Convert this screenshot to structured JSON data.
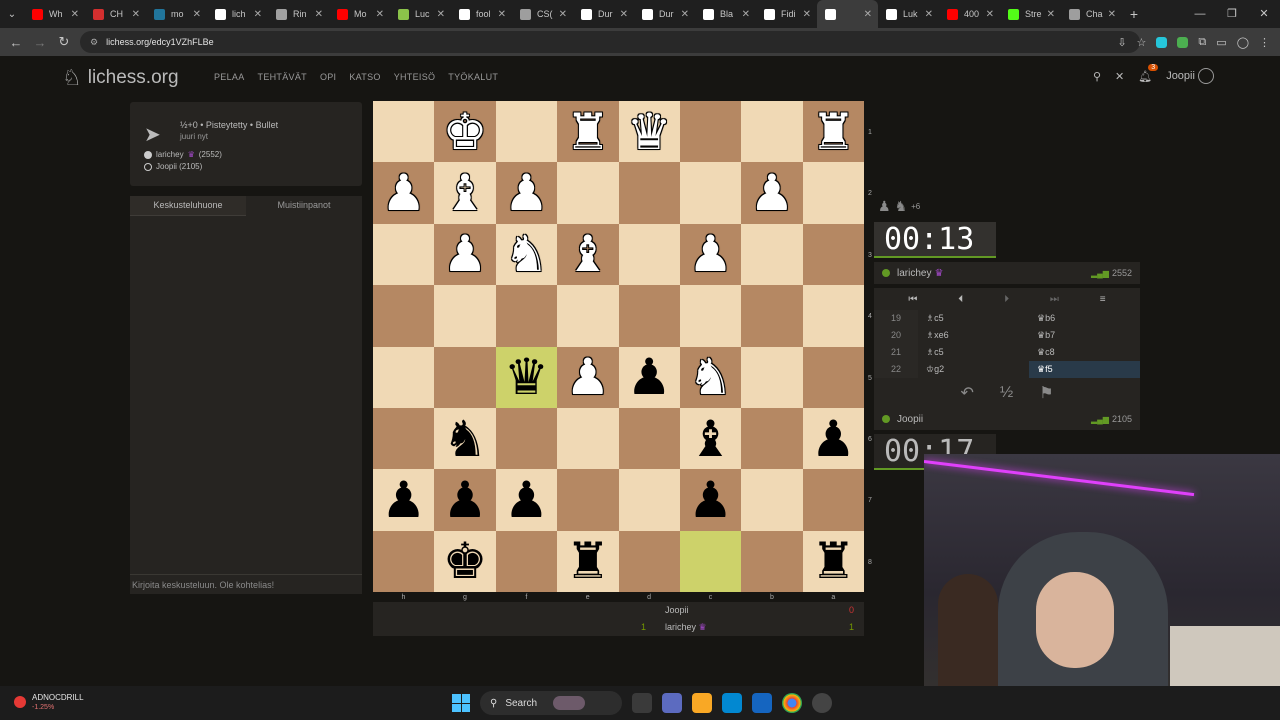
{
  "browser": {
    "tabs": [
      {
        "label": "Wh",
        "color": "#ff0000"
      },
      {
        "label": "CH",
        "color": "#d32f2f"
      },
      {
        "label": "mo",
        "color": "#21759b"
      },
      {
        "label": "lich",
        "color": "#ffffff"
      },
      {
        "label": "Rin",
        "color": "#a0a0a0"
      },
      {
        "label": "Mo",
        "color": "#ff0000"
      },
      {
        "label": "Luc",
        "color": "#8bc34a"
      },
      {
        "label": "fool",
        "color": "#ffffff"
      },
      {
        "label": "CS(",
        "color": "#9e9e9e"
      },
      {
        "label": "Dur",
        "color": "#ffffff"
      },
      {
        "label": "Dur",
        "color": "#ffffff"
      },
      {
        "label": "Bla",
        "color": "#ffffff"
      },
      {
        "label": "Fidi",
        "color": "#ffffff"
      },
      {
        "label": "",
        "color": "#ffffff",
        "active": true
      },
      {
        "label": "Luk",
        "color": "#ffffff"
      },
      {
        "label": "400",
        "color": "#ff0000"
      },
      {
        "label": "Stre",
        "color": "#53fc18"
      },
      {
        "label": "Cha",
        "color": "#9e9e9e"
      }
    ],
    "url": "lichess.org/edcy1VZhFLBe",
    "win_min": "—",
    "win_max": "❐",
    "win_close": "✕"
  },
  "header": {
    "brand": "lichess.org",
    "nav": [
      "PELAA",
      "TEHTÄVÄT",
      "OPI",
      "KATSO",
      "YHTEISÖ",
      "TYÖKALUT"
    ],
    "notif_count": "3",
    "username": "Joopii"
  },
  "game_info": {
    "setup": "½+0 • Pisteytetty • Bullet",
    "when": "juuri nyt",
    "white_player": "larichey",
    "white_rating": "(2552)",
    "black_player": "Joopii (2105)"
  },
  "chat": {
    "tab_chat": "Keskusteluhuone",
    "tab_notes": "Muistiinpanot",
    "input_placeholder": "Kirjoita keskusteluun. Ole kohtelias!"
  },
  "board": {
    "ranks": [
      "1",
      "2",
      "3",
      "4",
      "5",
      "6",
      "7",
      "8"
    ],
    "files": [
      "h",
      "g",
      "f",
      "e",
      "d",
      "c",
      "b",
      "a"
    ],
    "squares": [
      [
        "",
        "wK",
        "",
        "wR",
        "wQ",
        "",
        "",
        "wR"
      ],
      [
        "wP",
        "wB",
        "wP",
        "",
        "",
        "",
        "wP",
        ""
      ],
      [
        "",
        "wP",
        "wN",
        "wB",
        "",
        "wP",
        "",
        ""
      ],
      [
        "",
        "",
        "",
        "",
        "",
        "",
        "",
        ""
      ],
      [
        "",
        "",
        "bQ",
        "wP",
        "bP",
        "wN",
        "",
        ""
      ],
      [
        "",
        "bN",
        "",
        "",
        "",
        "bB",
        "",
        "bP"
      ],
      [
        "bP",
        "bP",
        "bP",
        "",
        "",
        "bP",
        "",
        ""
      ],
      [
        "",
        "bK",
        "",
        "bR",
        "",
        "",
        "",
        "bR"
      ]
    ],
    "highlight": [
      [
        4,
        2
      ],
      [
        7,
        5
      ]
    ]
  },
  "scoreboard": {
    "top_name": "Joopii",
    "top_score": "0",
    "bottom_name": "larichey",
    "bottom_left": "1",
    "bottom_score": "1"
  },
  "right_panel": {
    "material_plus": "+6",
    "top_clock": "00:13",
    "top_player": "larichey",
    "top_rating": "2552",
    "bottom_clock": "00:17",
    "bottom_player": "Joopii",
    "bottom_rating": "2105",
    "moves": [
      {
        "num": "19",
        "white": "♗c5",
        "black": "♛b6"
      },
      {
        "num": "20",
        "white": "♗xe6",
        "black": "♛b7"
      },
      {
        "num": "21",
        "white": "♗c5",
        "black": "♛c8"
      },
      {
        "num": "22",
        "white": "♔g2",
        "black": "♛f5"
      }
    ],
    "draw_label": "½"
  },
  "taskbar": {
    "ticker": "ADNOCDRILL",
    "change": "-1.25%",
    "search": "Search"
  }
}
